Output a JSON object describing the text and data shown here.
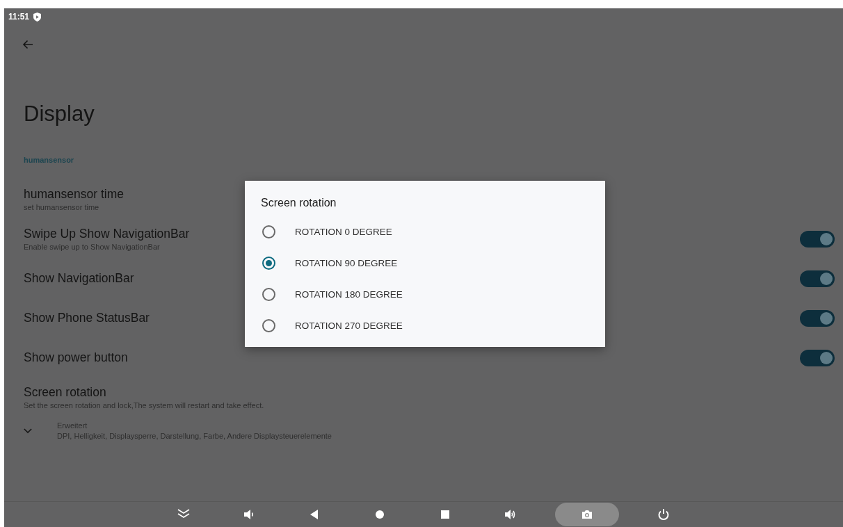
{
  "status_bar": {
    "time": "11:51"
  },
  "page": {
    "title": "Display",
    "category": "humansensor"
  },
  "settings": [
    {
      "kind": "plain",
      "title": "humansensor time",
      "summary": "set humansensor time"
    },
    {
      "kind": "toggle",
      "title": "Swipe Up Show NavigationBar",
      "summary": "Enable swipe up to Show NavigationBar",
      "on": true
    },
    {
      "kind": "toggle",
      "title": "Show NavigationBar",
      "on": true
    },
    {
      "kind": "toggle",
      "title": "Show Phone StatusBar",
      "on": true
    },
    {
      "kind": "toggle",
      "title": "Show power button",
      "on": true
    },
    {
      "kind": "plain",
      "title": "Screen rotation",
      "summary": "Set the screen rotation and lock,The system will restart and take effect."
    }
  ],
  "advanced": {
    "title": "Erweitert",
    "summary": "DPI, Helligkeit, Displaysperre, Darstellung, Farbe, Andere Displaysteuerelemente"
  },
  "dialog": {
    "title": "Screen rotation",
    "options": [
      {
        "label": "ROTATION 0 DEGREE",
        "selected": false
      },
      {
        "label": "ROTATION 90 DEGREE",
        "selected": true
      },
      {
        "label": "ROTATION 180 DEGREE",
        "selected": false
      },
      {
        "label": "ROTATION 270 DEGREE",
        "selected": false
      }
    ]
  },
  "nav_bar": {
    "buttons": [
      {
        "kind": "collapse",
        "selected": false
      },
      {
        "kind": "volume_down",
        "selected": false
      },
      {
        "kind": "back",
        "selected": false
      },
      {
        "kind": "home",
        "selected": false
      },
      {
        "kind": "recents",
        "selected": false
      },
      {
        "kind": "volume_up",
        "selected": false
      },
      {
        "kind": "screenshot",
        "selected": true
      },
      {
        "kind": "power",
        "selected": false
      }
    ]
  }
}
